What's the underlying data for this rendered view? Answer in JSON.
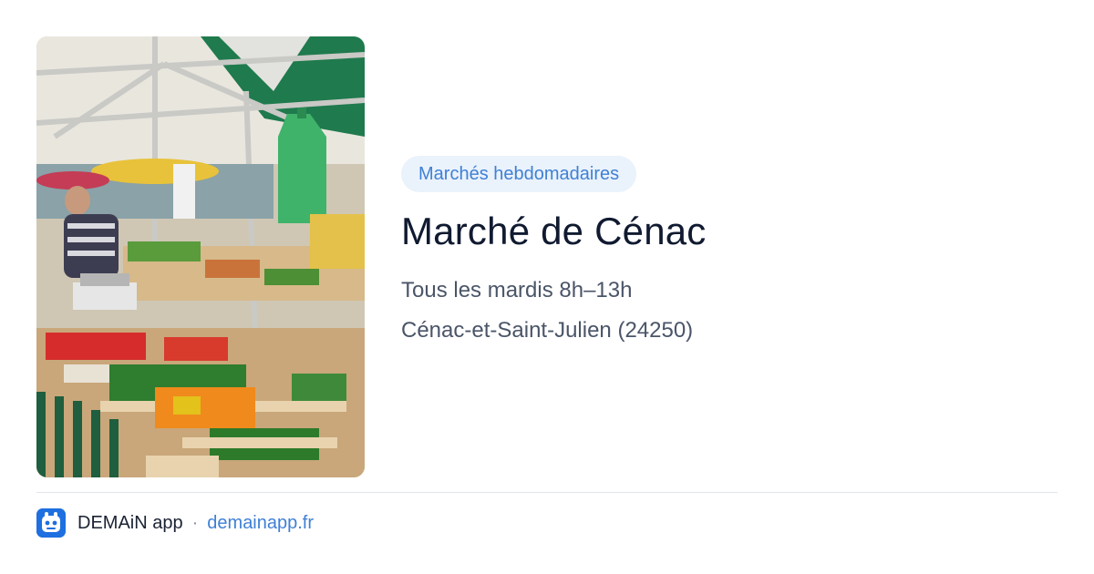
{
  "card": {
    "category_tag": "Marchés hebdomadaires",
    "title": "Marché de Cénac",
    "schedule": "Tous les mardis 8h–13h",
    "location": "Cénac-et-Saint-Julien (24250)"
  },
  "footer": {
    "app_name": "DEMAiN app",
    "separator": "·",
    "website": "demainapp.fr"
  },
  "colors": {
    "accent": "#3f80d6",
    "tag_background": "#eaf2fb",
    "title": "#101a30",
    "body_text": "#4a5568",
    "logo_background": "#1e6fe0"
  },
  "icons": {
    "app_logo": "demain-logo-icon"
  }
}
